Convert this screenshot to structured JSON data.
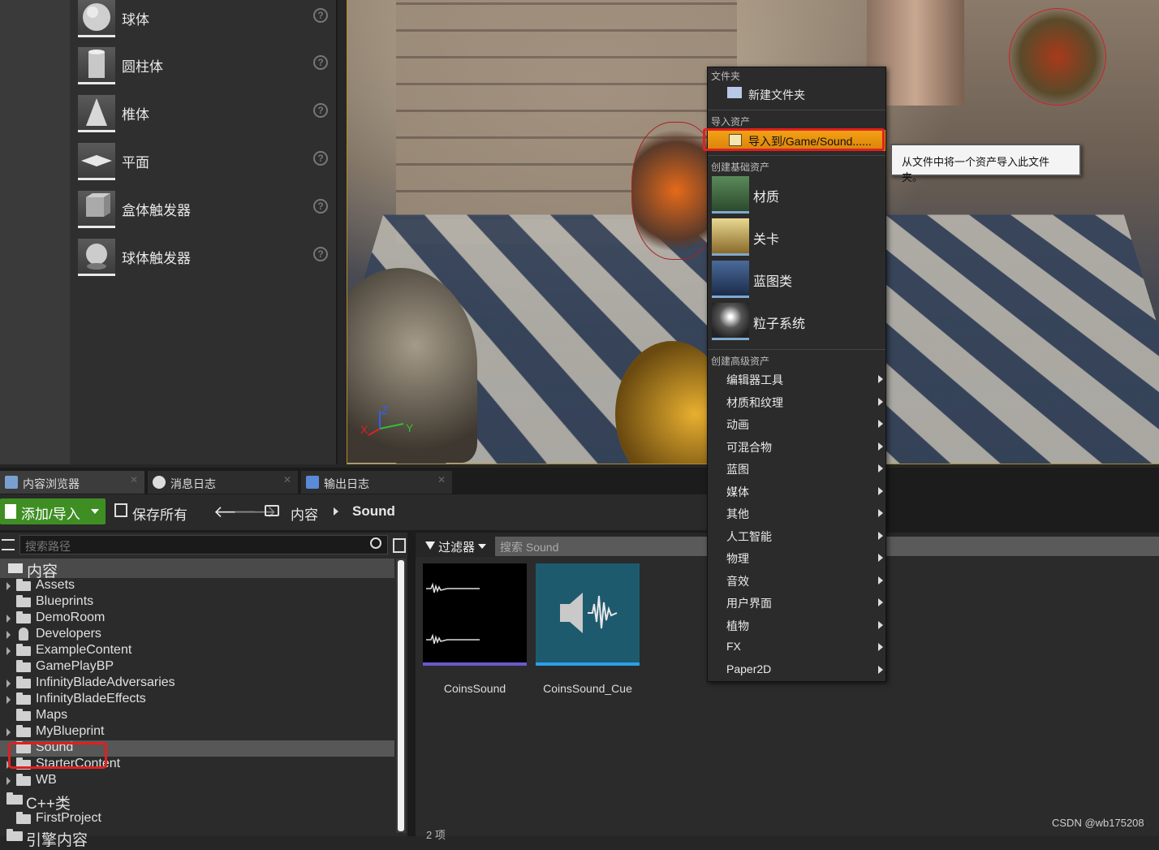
{
  "place_actors": {
    "items": [
      {
        "label": "球体",
        "icon": "sphere-icon"
      },
      {
        "label": "圆柱体",
        "icon": "cylinder-icon"
      },
      {
        "label": "椎体",
        "icon": "cone-icon"
      },
      {
        "label": "平面",
        "icon": "plane-icon"
      },
      {
        "label": "盒体触发器",
        "icon": "box-trigger-icon"
      },
      {
        "label": "球体触发器",
        "icon": "sphere-trigger-icon"
      }
    ]
  },
  "viewport": {
    "gizmo": {
      "x": "X",
      "y": "Y",
      "z": "Z"
    }
  },
  "context_menu": {
    "section_folder": "文件夹",
    "new_folder": "新建文件夹",
    "section_import": "导入资产",
    "import_to": "导入到/Game/Sound......",
    "section_basic": "创建基础资产",
    "basic_items": [
      "材质",
      "关卡",
      "蓝图类",
      "粒子系统"
    ],
    "section_advanced": "创建高级资产",
    "advanced_items": [
      "编辑器工具",
      "材质和纹理",
      "动画",
      "可混合物",
      "蓝图",
      "媒体",
      "其他",
      "人工智能",
      "物理",
      "音效",
      "用户界面",
      "植物",
      "FX",
      "Paper2D"
    ]
  },
  "tooltip": {
    "text": "从文件中将一个资产导入此文件夹。"
  },
  "tabs": [
    {
      "label": "内容浏览器",
      "icon": "content-browser-icon"
    },
    {
      "label": "消息日志",
      "icon": "message-log-icon"
    },
    {
      "label": "输出日志",
      "icon": "output-log-icon"
    }
  ],
  "toolbar": {
    "add_import": "添加/导入",
    "save_all": "保存所有",
    "breadcrumb_root": "内容",
    "breadcrumb_current": "Sound"
  },
  "tree": {
    "search_placeholder": "搜索路径",
    "root": "内容",
    "folders": [
      "Assets",
      "Blueprints",
      "DemoRoom",
      "Developers",
      "ExampleContent",
      "GamePlayBP",
      "InfinityBladeAdversaries",
      "InfinityBladeEffects",
      "Maps",
      "MyBlueprint",
      "Sound",
      "StarterContent",
      "WB"
    ],
    "cpp_root": "C++类",
    "cpp_child": "FirstProject",
    "engine_root": "引擎内容"
  },
  "assets": {
    "filter_label": "过滤器",
    "search_placeholder": "搜索 Sound",
    "items": [
      {
        "name": "CoinsSound",
        "type_color": "#6a5acd"
      },
      {
        "name": "CoinsSound_Cue",
        "type_color": "#2aa0e8"
      }
    ],
    "count": "2 项"
  },
  "watermark": "CSDN @wb175208",
  "colors": {
    "accent_orange": "#f4a214",
    "add_green": "#3f8e24",
    "highlight_red": "#e02020"
  }
}
